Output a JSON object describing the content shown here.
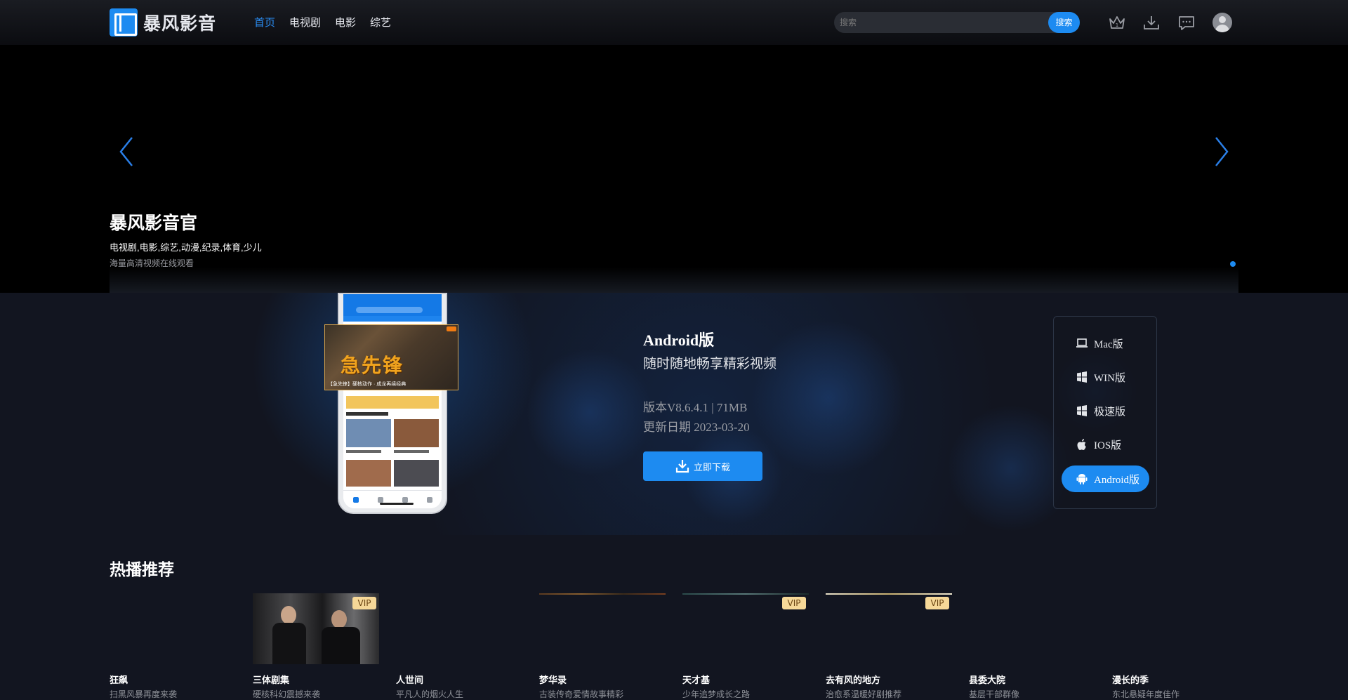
{
  "header": {
    "logo_text": "暴风影音",
    "nav": [
      "首页",
      "电视剧",
      "电影",
      "综艺"
    ],
    "search": {
      "placeholder": "搜索",
      "button": "搜索"
    },
    "icons": [
      "vip-crown-icon",
      "download-icon",
      "message-icon",
      "avatar"
    ]
  },
  "banner": {
    "title": "暴风影音官",
    "tags": "电视剧,电影,综艺,动漫,纪录,体育,少儿",
    "desc": "海量高清视频在线观看"
  },
  "download": {
    "poster_title": "急先锋",
    "poster_caption": "【急先锋】硬核动作 · 成龙再续经典",
    "title": "Android版",
    "subtitle": "随时随地畅享精彩视频",
    "version": "版本V8.6.4.1 | 71MB",
    "date": "更新日期 2023-03-20",
    "button": "立即下载",
    "platforms": [
      {
        "label": "Mac版",
        "icon": "laptop-icon"
      },
      {
        "label": "WIN版",
        "icon": "windows-icon"
      },
      {
        "label": "极速版",
        "icon": "windows-icon"
      },
      {
        "label": "IOS版",
        "icon": "apple-icon"
      },
      {
        "label": "Android版",
        "icon": "android-icon",
        "active": true
      }
    ]
  },
  "hot": {
    "title": "热播推荐",
    "items": [
      {
        "name": "狂飙",
        "desc": "扫黑风暴再度来袭",
        "vip": false
      },
      {
        "name": "三体剧集",
        "desc": "硬核科幻震撼来袭",
        "vip": true
      },
      {
        "name": "人世间",
        "desc": "平凡人的烟火人生",
        "vip": false
      },
      {
        "name": "梦华录",
        "desc": "古装传奇爱情故事精彩",
        "vip": false
      },
      {
        "name": "天才基",
        "desc": "少年追梦成长之路",
        "vip": true
      },
      {
        "name": "去有风的地方",
        "desc": "治愈系温暖好剧推荐",
        "vip": true
      },
      {
        "name": "县委大院",
        "desc": "基层干部群像",
        "vip": false
      },
      {
        "name": "漫长的季",
        "desc": "东北悬疑年度佳作",
        "vip": false
      }
    ]
  }
}
